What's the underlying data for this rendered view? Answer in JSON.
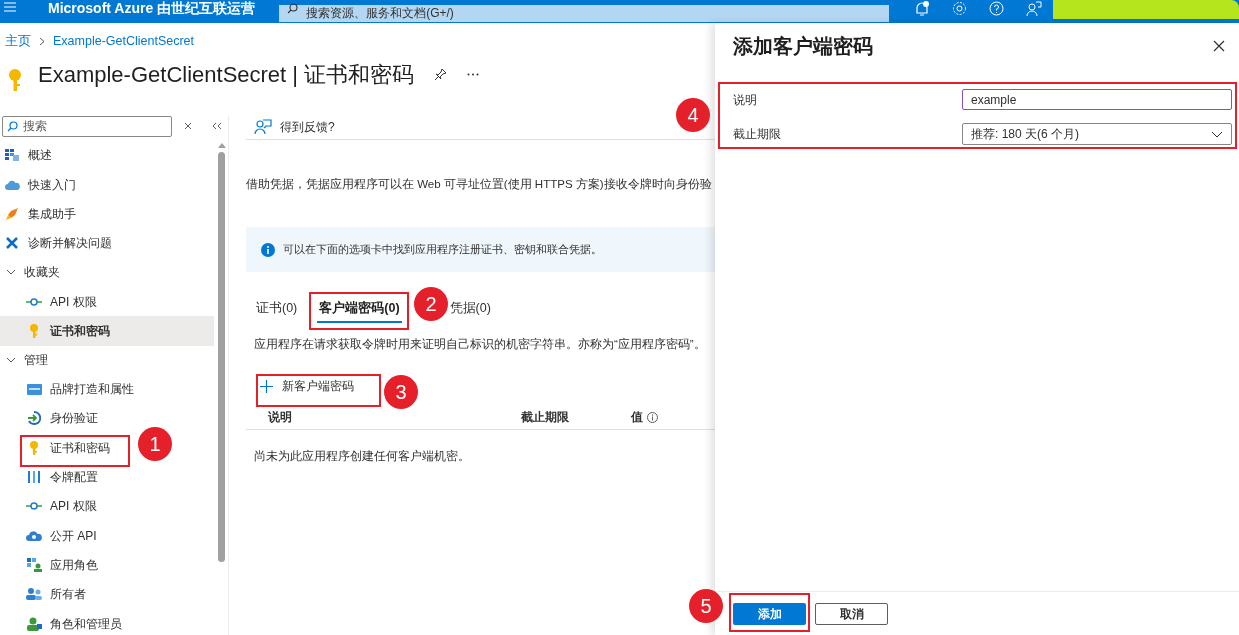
{
  "top_bar": {
    "brand": "Microsoft Azure 由世纪互联运营",
    "search": {
      "placeholder": "搜索资源、服务和文档(G+/)"
    }
  },
  "breadcrumb": [
    "主页",
    "Example-GetClientSecret"
  ],
  "page_title": "Example-GetClientSecret | 证书和密码",
  "sidebar": {
    "search": {
      "placeholder": "搜索"
    },
    "items": [
      {
        "kind": "link",
        "label": "概述",
        "selected": false
      },
      {
        "kind": "link",
        "label": "快速入门",
        "selected": false
      },
      {
        "kind": "link",
        "label": "集成助手",
        "selected": false
      },
      {
        "kind": "link",
        "label": "诊断并解决问题",
        "selected": false
      },
      {
        "kind": "group",
        "label": "收藏夹",
        "expanded": true,
        "children": [
          {
            "kind": "link",
            "label": "API 权限",
            "selected": false
          },
          {
            "kind": "link",
            "label": "证书和密码",
            "selected": true
          }
        ]
      },
      {
        "kind": "group",
        "label": "管理",
        "expanded": true,
        "children": [
          {
            "kind": "link",
            "label": "品牌打造和属性",
            "selected": false
          },
          {
            "kind": "link",
            "label": "身份验证",
            "selected": false
          },
          {
            "kind": "link",
            "label": "证书和密码",
            "selected": false
          },
          {
            "kind": "link",
            "label": "令牌配置",
            "selected": false
          },
          {
            "kind": "link",
            "label": "API 权限",
            "selected": false
          },
          {
            "kind": "link",
            "label": "公开 API",
            "selected": false
          },
          {
            "kind": "link",
            "label": "应用角色",
            "selected": false
          },
          {
            "kind": "link",
            "label": "所有者",
            "selected": false
          },
          {
            "kind": "link",
            "label": "角色和管理员",
            "selected": false
          }
        ]
      }
    ]
  },
  "main": {
    "feedback": "得到反馈?",
    "description": "借助凭据，凭据应用程序可以在 Web 可寻址位置(使用 HTTPS 方案)接收令牌时向身份验",
    "info": "可以在下面的选项卡中找到应用程序注册证书、密钥和联合凭据。",
    "tabs": [
      {
        "label": "证书(0)",
        "selected": false
      },
      {
        "label": "客户端密码(0)",
        "selected": true
      },
      {
        "label": "凭据(0)",
        "selected": false
      }
    ],
    "tab_description": "应用程序在请求获取令牌时用来证明自己标识的机密字符串。亦称为“应用程序密码”。",
    "new_button": "新客户端密码",
    "table": {
      "columns": [
        "说明",
        "截止期限",
        "值"
      ],
      "empty_text": "尚未为此应用程序创建任何客户端机密。"
    }
  },
  "panel": {
    "title": "添加客户端密码",
    "fields": [
      {
        "kind": "text",
        "label": "说明",
        "value": "example"
      },
      {
        "kind": "select",
        "label": "截止期限",
        "value": "推荐: 180 天(6 个月)"
      }
    ],
    "buttons": [
      {
        "label": "添加",
        "primary": true
      },
      {
        "label": "取消",
        "primary": false
      }
    ]
  },
  "annotations": [
    "1",
    "2",
    "3",
    "4",
    "5"
  ]
}
